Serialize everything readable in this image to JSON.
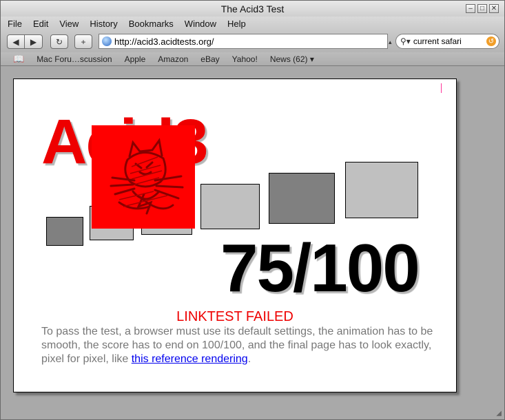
{
  "window": {
    "title": "The Acid3 Test"
  },
  "window_buttons": [
    "–",
    "□",
    "✕"
  ],
  "menu": [
    "File",
    "Edit",
    "View",
    "History",
    "Bookmarks",
    "Window",
    "Help"
  ],
  "toolbar": {
    "back_icon": "back-arrow-icon",
    "forward_icon": "forward-arrow-icon",
    "reload_icon": "reload-icon",
    "add_icon": "add-bookmark-icon",
    "url": "http://acid3.acidtests.org/",
    "search_value": "current safari"
  },
  "bookmarks": [
    "Mac Foru…scussion",
    "Apple",
    "Amazon",
    "eBay",
    "Yahoo!",
    "News (62)"
  ],
  "page": {
    "heading": "Acid3",
    "score": "75/100",
    "status": "LINKTEST FAILED",
    "description_before": "To pass the test, a browser must use its default settings, the animation has to be smooth, the score has to end on 100/100, and the final page has to look exactly, pixel for pixel, like ",
    "link_text": "this reference rendering",
    "description_after": "."
  },
  "colors": {
    "heading": "#ee0000",
    "status": "#ee0000",
    "link": "#0000ee",
    "box_dark": "#808080",
    "box_light": "#c0c0c0"
  }
}
